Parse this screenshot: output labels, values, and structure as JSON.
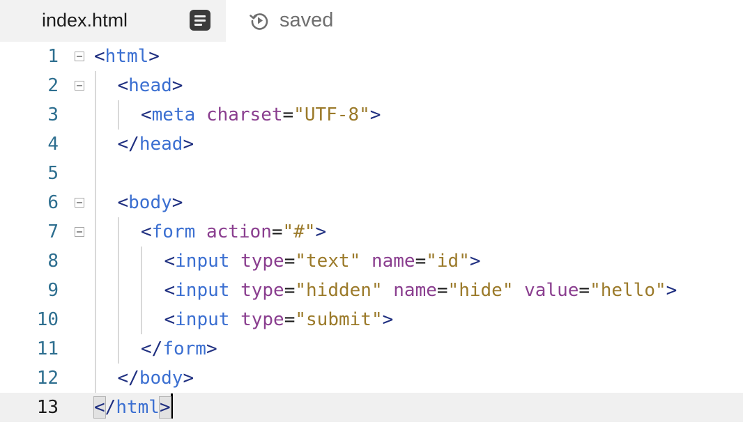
{
  "tab": {
    "filename": "index.html",
    "menu_icon": "list-icon",
    "status_icon": "history-icon",
    "status": "saved"
  },
  "editor": {
    "active_line": 13,
    "lines": [
      {
        "n": "1",
        "foldable": true,
        "indent": 0,
        "tokens": [
          [
            "br",
            "<"
          ],
          [
            "tag",
            "html"
          ],
          [
            "br",
            ">"
          ]
        ]
      },
      {
        "n": "2",
        "foldable": true,
        "indent": 1,
        "tokens": [
          [
            "br",
            "<"
          ],
          [
            "tag",
            "head"
          ],
          [
            "br",
            ">"
          ]
        ]
      },
      {
        "n": "3",
        "foldable": false,
        "indent": 2,
        "tokens": [
          [
            "br",
            "<"
          ],
          [
            "tag",
            "meta"
          ],
          [
            "sp",
            " "
          ],
          [
            "attr",
            "charset"
          ],
          [
            "eq",
            "="
          ],
          [
            "str",
            "\"UTF-8\""
          ],
          [
            "br",
            ">"
          ]
        ]
      },
      {
        "n": "4",
        "foldable": false,
        "indent": 1,
        "tokens": [
          [
            "br",
            "</"
          ],
          [
            "tag",
            "head"
          ],
          [
            "br",
            ">"
          ]
        ]
      },
      {
        "n": "5",
        "foldable": false,
        "indent": 0,
        "tokens": []
      },
      {
        "n": "6",
        "foldable": true,
        "indent": 1,
        "tokens": [
          [
            "br",
            "<"
          ],
          [
            "tag",
            "body"
          ],
          [
            "br",
            ">"
          ]
        ]
      },
      {
        "n": "7",
        "foldable": true,
        "indent": 2,
        "tokens": [
          [
            "br",
            "<"
          ],
          [
            "tag",
            "form"
          ],
          [
            "sp",
            " "
          ],
          [
            "attr",
            "action"
          ],
          [
            "eq",
            "="
          ],
          [
            "str",
            "\"#\""
          ],
          [
            "br",
            ">"
          ]
        ]
      },
      {
        "n": "8",
        "foldable": false,
        "indent": 3,
        "tokens": [
          [
            "br",
            "<"
          ],
          [
            "tag",
            "input"
          ],
          [
            "sp",
            " "
          ],
          [
            "attr",
            "type"
          ],
          [
            "eq",
            "="
          ],
          [
            "str",
            "\"text\""
          ],
          [
            "sp",
            " "
          ],
          [
            "attr",
            "name"
          ],
          [
            "eq",
            "="
          ],
          [
            "str",
            "\"id\""
          ],
          [
            "br",
            ">"
          ]
        ]
      },
      {
        "n": "9",
        "foldable": false,
        "indent": 3,
        "tokens": [
          [
            "br",
            "<"
          ],
          [
            "tag",
            "input"
          ],
          [
            "sp",
            " "
          ],
          [
            "attr",
            "type"
          ],
          [
            "eq",
            "="
          ],
          [
            "str",
            "\"hidden\""
          ],
          [
            "sp",
            " "
          ],
          [
            "attr",
            "name"
          ],
          [
            "eq",
            "="
          ],
          [
            "str",
            "\"hide\""
          ],
          [
            "sp",
            " "
          ],
          [
            "attr",
            "value"
          ],
          [
            "eq",
            "="
          ],
          [
            "str",
            "\"hello\""
          ],
          [
            "br",
            ">"
          ]
        ]
      },
      {
        "n": "10",
        "foldable": false,
        "indent": 3,
        "tokens": [
          [
            "br",
            "<"
          ],
          [
            "tag",
            "input"
          ],
          [
            "sp",
            " "
          ],
          [
            "attr",
            "type"
          ],
          [
            "eq",
            "="
          ],
          [
            "str",
            "\"submit\""
          ],
          [
            "br",
            ">"
          ]
        ]
      },
      {
        "n": "11",
        "foldable": false,
        "indent": 2,
        "tokens": [
          [
            "br",
            "</"
          ],
          [
            "tag",
            "form"
          ],
          [
            "br",
            ">"
          ]
        ]
      },
      {
        "n": "12",
        "foldable": false,
        "indent": 1,
        "tokens": [
          [
            "br",
            "</"
          ],
          [
            "tag",
            "body"
          ],
          [
            "br",
            ">"
          ]
        ]
      },
      {
        "n": "13",
        "foldable": false,
        "indent": 0,
        "tokens": [
          [
            "br",
            "</"
          ],
          [
            "tag",
            "html"
          ],
          [
            "br",
            ">"
          ]
        ]
      }
    ]
  }
}
